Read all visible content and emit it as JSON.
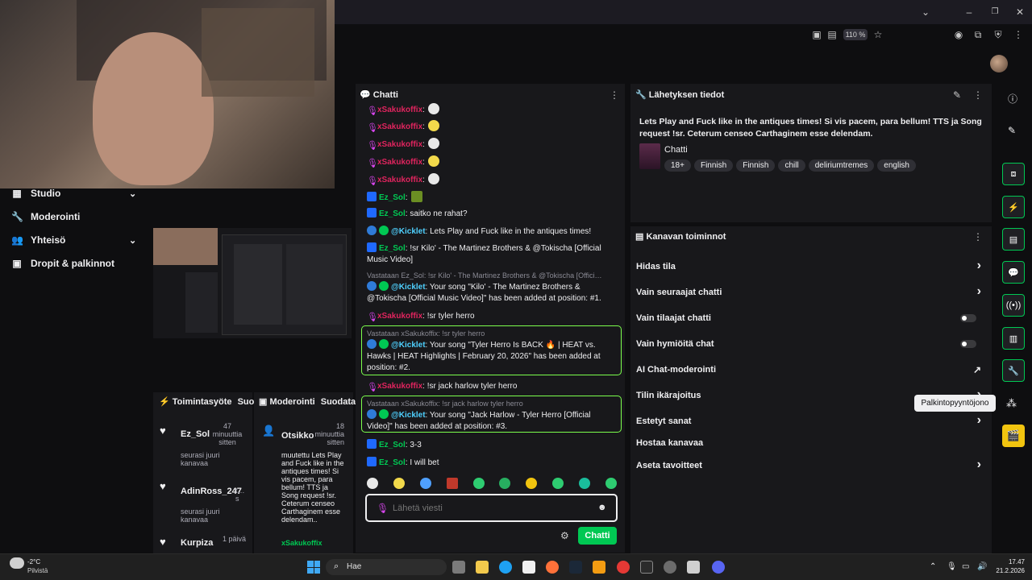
{
  "browser": {
    "zoom": "110 %"
  },
  "left_nav": {
    "items": [
      {
        "label": "Studio",
        "icon": "studio-icon",
        "expandable": true
      },
      {
        "label": "Moderointi",
        "icon": "wrench-icon",
        "expandable": false
      },
      {
        "label": "Yhteisö",
        "icon": "community-icon",
        "expandable": true
      },
      {
        "label": "Dropit & palkinnot",
        "icon": "gift-icon",
        "expandable": false
      }
    ]
  },
  "activity": {
    "title": "Toimintasyöte",
    "filter": "Suoc",
    "events": [
      {
        "name": "Ez_Sol",
        "time": "47 minuuttia sitten",
        "desc": "seurasi juuri kanavaa"
      },
      {
        "name": "AdinRoss_247",
        "time": "t… s",
        "desc": "seurasi juuri kanavaa"
      },
      {
        "name": "Kurpiza",
        "time": "1 päivä",
        "desc": ""
      }
    ]
  },
  "modlog": {
    "title": "Moderointi",
    "filter": "Suodata",
    "entry": {
      "name": "Otsikko",
      "time": "18 minuuttia sitten",
      "text": "muutettu Lets Play and Fuck like in the antiques times! Si vis pacem, para bellum! TTS ja Song request !sr. Ceterum censeo Carthaginem esse delendam..",
      "user": "xSakukoffix"
    }
  },
  "chat": {
    "title": "Chatti",
    "messages": [
      {
        "user": "xSakukoffix",
        "text": ":",
        "kind": "x"
      },
      {
        "user": "xSakukoffix",
        "text": ":",
        "kind": "x"
      },
      {
        "user": "xSakukoffix",
        "text": ":",
        "kind": "x"
      },
      {
        "user": "xSakukoffix",
        "text": ":",
        "kind": "x"
      },
      {
        "user": "xSakukoffix",
        "text": ":",
        "kind": "x"
      },
      {
        "user": "Ez_Sol",
        "text": ":",
        "kind": "ez"
      },
      {
        "user": "Ez_Sol",
        "text": ": saitko ne rahat?",
        "kind": "ez"
      },
      {
        "user": "@Kicklet",
        "text": ": Lets Play and Fuck like in the antiques times!",
        "kind": "k"
      },
      {
        "user": "Ez_Sol",
        "text": ": !sr Kilo' - The Martinez Brothers & @Tokischa [Official Music Video]",
        "kind": "ez"
      },
      {
        "reply": "Vastataan Ez_Sol: !sr Kilo' - The Martinez Brothers & @Tokischa [Offici…",
        "user": "@Kicklet",
        "text": ": Your song \"Kilo' - The Martinez Brothers & @Tokischa [Official Music Video]\" has been added at position: #1.",
        "kind": "k"
      },
      {
        "user": "xSakukoffix",
        "text": ": !sr tyler herro",
        "kind": "x"
      },
      {
        "reply": "Vastataan xSakukoffix: !sr tyler herro",
        "user": "@Kicklet",
        "text": ": Your song \"Tyler Herro Is BACK 🔥 | HEAT vs. Hawks | HEAT Highlights | February 20, 2026\" has been added at position: #2.",
        "kind": "k"
      },
      {
        "user": "xSakukoffix",
        "text": ": !sr jack harlow tyler herro",
        "kind": "x"
      },
      {
        "reply": "Vastataan xSakukoffix: !sr jack harlow tyler herro",
        "user": "@Kicklet",
        "text": ": Your song \"Jack Harlow - Tyler Herro [Official Video]\" has been added at position: #3.",
        "kind": "k"
      },
      {
        "user": "Ez_Sol",
        "text": ": 3-3",
        "kind": "ez"
      },
      {
        "user": "Ez_Sol",
        "text": ": I will bet",
        "kind": "ez"
      }
    ],
    "input_placeholder": "Lähetä viesti",
    "send_label": "Chatti"
  },
  "stream_info": {
    "title": "Lähetyksen tiedot",
    "stream_title": "Lets Play and Fuck like in the antiques times! Si vis pacem, para bellum! TTS ja Song request !sr. Ceterum censeo Carthaginem esse delendam.",
    "category": "Chatti",
    "tags": [
      "18+",
      "Finnish",
      "Finnish",
      "chill",
      "deliriumtremes",
      "english"
    ]
  },
  "channel_actions": {
    "title": "Kanavan toiminnot",
    "rows": [
      {
        "label": "Hidas tila",
        "control": "chevron"
      },
      {
        "label": "Vain seuraajat chatti",
        "control": "chevron"
      },
      {
        "label": "Vain tilaajat chatti",
        "control": "toggle"
      },
      {
        "label": "Vain hymiöitä chat",
        "control": "toggle"
      },
      {
        "label": "AI Chat-moderointi",
        "control": "external"
      },
      {
        "label": "Tilin ikärajoitus",
        "control": "chevron"
      },
      {
        "label": "Estetyt sanat",
        "control": "chevron"
      },
      {
        "label": "Hostaa kanavaa",
        "control": "none"
      },
      {
        "label": "Aseta tavoitteet",
        "control": "chevron"
      }
    ]
  },
  "tooltip": "Palkintopyyntöjono",
  "taskbar": {
    "weather_temp": "-2°C",
    "weather_desc": "Pilvistä",
    "search_label": "Hae",
    "time": "17.47",
    "date": "21.2.2026"
  },
  "colors": {
    "accent": "#00c853",
    "highlight_border": "#7cff4c",
    "xname": "#e0245e"
  }
}
